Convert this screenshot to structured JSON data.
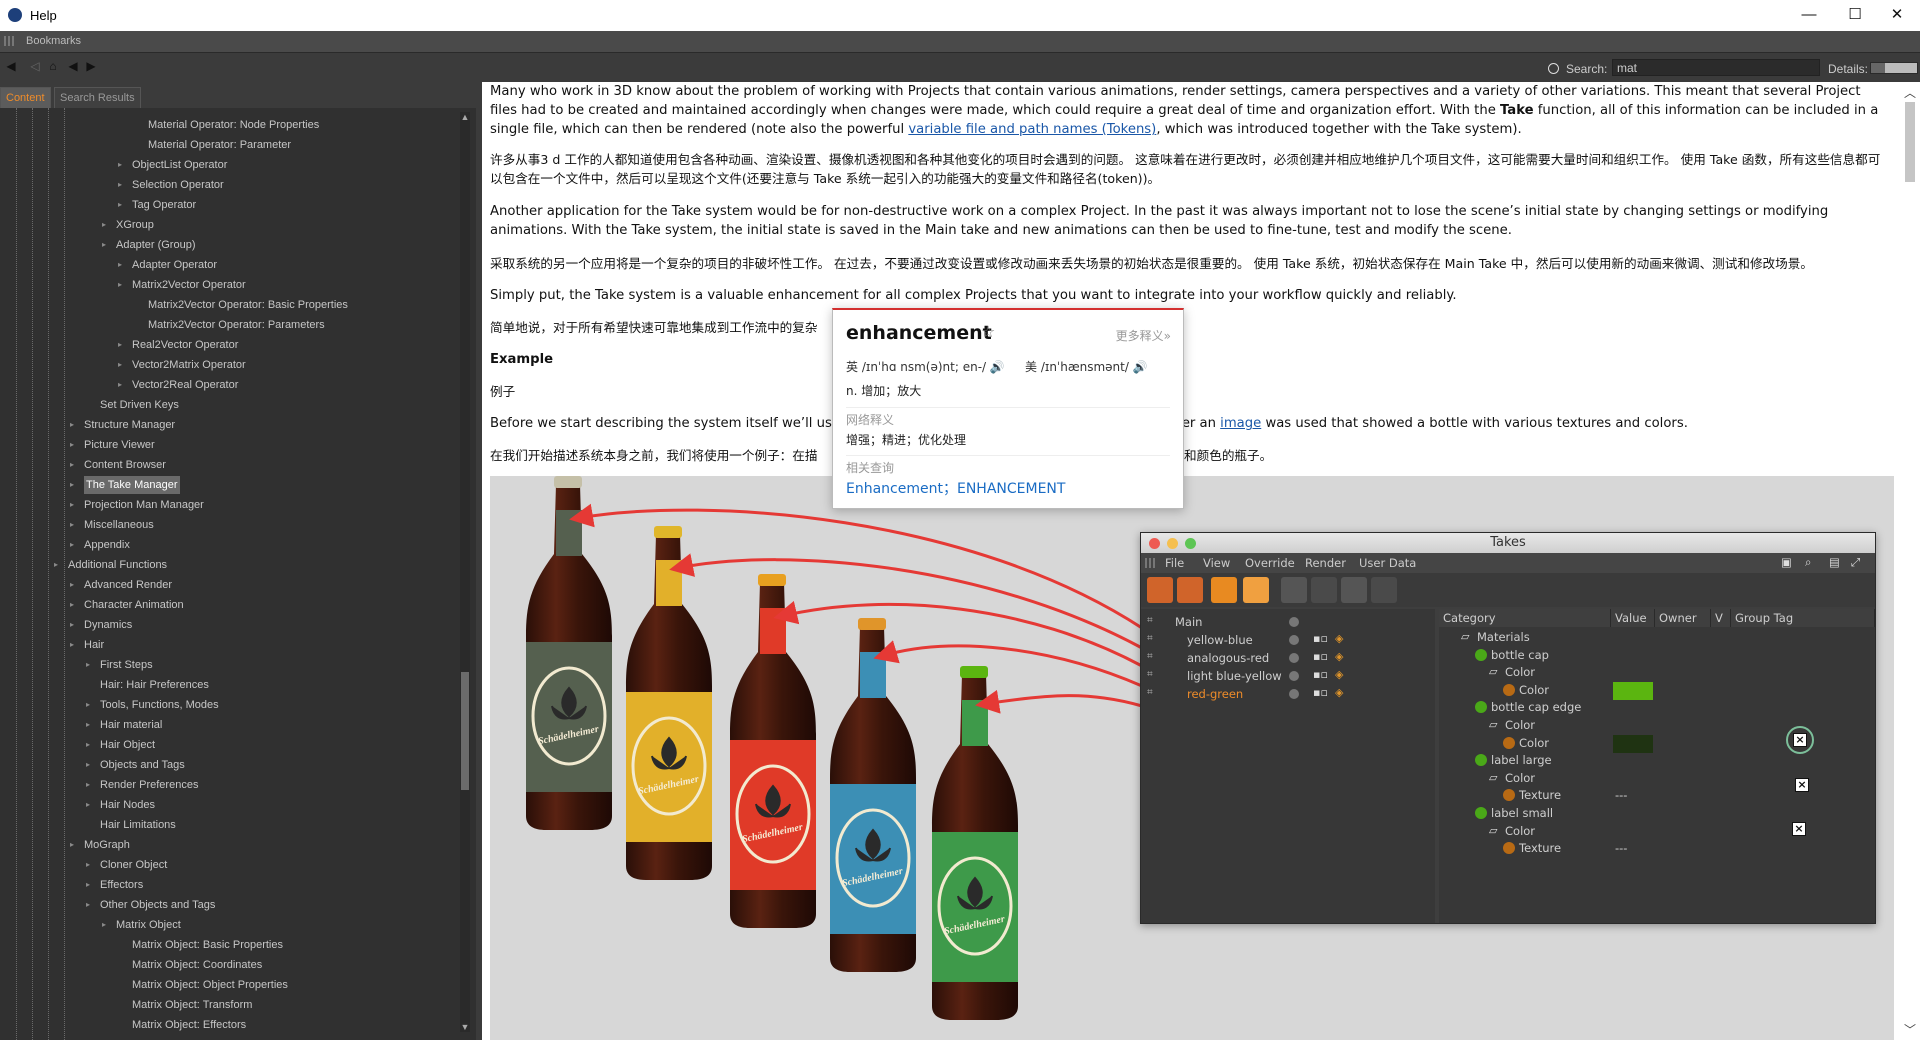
{
  "window": {
    "title": "Help",
    "minimize": "—",
    "maximize": "☐",
    "close": "✕"
  },
  "bookmarks": {
    "label": "Bookmarks"
  },
  "toolbar": {
    "search_label": "Search:",
    "search_value": "mat",
    "details_label": "Details:",
    "details_level": 0.7
  },
  "tabs": [
    {
      "label": "Content",
      "active": true
    },
    {
      "label": "Search Results",
      "active": false
    }
  ],
  "sidebar": {
    "items": [
      {
        "label": "Material Operator: Node Properties",
        "level": 5,
        "expandable": false
      },
      {
        "label": "Material Operator: Parameter",
        "level": 5,
        "expandable": false
      },
      {
        "label": "ObjectList Operator",
        "level": 4,
        "expandable": true
      },
      {
        "label": "Selection Operator",
        "level": 4,
        "expandable": true
      },
      {
        "label": "Tag Operator",
        "level": 4,
        "expandable": true
      },
      {
        "label": "XGroup",
        "level": 3,
        "expandable": true
      },
      {
        "label": "Adapter (Group)",
        "level": 3,
        "expandable": true
      },
      {
        "label": "Adapter Operator",
        "level": 4,
        "expandable": true
      },
      {
        "label": "Matrix2Vector Operator",
        "level": 4,
        "expandable": true
      },
      {
        "label": "Matrix2Vector Operator: Basic Properties",
        "level": 5,
        "expandable": false
      },
      {
        "label": "Matrix2Vector Operator: Parameters",
        "level": 5,
        "expandable": false
      },
      {
        "label": "Real2Vector Operator",
        "level": 4,
        "expandable": true
      },
      {
        "label": "Vector2Matrix Operator",
        "level": 4,
        "expandable": true
      },
      {
        "label": "Vector2Real Operator",
        "level": 4,
        "expandable": true
      },
      {
        "label": "Set Driven Keys",
        "level": 2,
        "expandable": false
      },
      {
        "label": "Structure Manager",
        "level": 1,
        "expandable": true
      },
      {
        "label": "Picture Viewer",
        "level": 1,
        "expandable": true
      },
      {
        "label": "Content Browser",
        "level": 1,
        "expandable": true
      },
      {
        "label": "The Take Manager",
        "level": 1,
        "expandable": true,
        "selected": true
      },
      {
        "label": "Projection Man Manager",
        "level": 1,
        "expandable": true
      },
      {
        "label": "Miscellaneous",
        "level": 1,
        "expandable": true
      },
      {
        "label": "Appendix",
        "level": 1,
        "expandable": true
      },
      {
        "label": "Additional Functions",
        "level": 0,
        "expandable": true
      },
      {
        "label": "Advanced Render",
        "level": 1,
        "expandable": true
      },
      {
        "label": "Character Animation",
        "level": 1,
        "expandable": true
      },
      {
        "label": "Dynamics",
        "level": 1,
        "expandable": true
      },
      {
        "label": "Hair",
        "level": 1,
        "expandable": true
      },
      {
        "label": "First Steps",
        "level": 2,
        "expandable": true
      },
      {
        "label": "Hair: Hair Preferences",
        "level": 2,
        "expandable": false
      },
      {
        "label": "Tools, Functions, Modes",
        "level": 2,
        "expandable": true
      },
      {
        "label": "Hair material",
        "level": 2,
        "expandable": true
      },
      {
        "label": "Hair Object",
        "level": 2,
        "expandable": true
      },
      {
        "label": "Objects and Tags",
        "level": 2,
        "expandable": true
      },
      {
        "label": "Render Preferences",
        "level": 2,
        "expandable": true
      },
      {
        "label": "Hair Nodes",
        "level": 2,
        "expandable": true
      },
      {
        "label": "Hair Limitations",
        "level": 2,
        "expandable": false
      },
      {
        "label": "MoGraph",
        "level": 1,
        "expandable": true
      },
      {
        "label": "Cloner Object",
        "level": 2,
        "expandable": true
      },
      {
        "label": "Effectors",
        "level": 2,
        "expandable": true
      },
      {
        "label": "Other Objects and Tags",
        "level": 2,
        "expandable": true
      },
      {
        "label": "Matrix Object",
        "level": 3,
        "expandable": true
      },
      {
        "label": "Matrix Object: Basic Properties",
        "level": 4,
        "expandable": false
      },
      {
        "label": "Matrix Object: Coordinates",
        "level": 4,
        "expandable": false
      },
      {
        "label": "Matrix Object: Object Properties",
        "level": 4,
        "expandable": false
      },
      {
        "label": "Matrix Object: Transform",
        "level": 4,
        "expandable": false
      },
      {
        "label": "Matrix Object: Effectors",
        "level": 4,
        "expandable": false
      }
    ]
  },
  "content": {
    "p1a": "Many who work in 3D know about the problem of working with Projects that contain various animations, render settings, camera perspectives and a variety of other variations. This meant that several Project files had to be created and maintained accordingly when changes were made, which could require a great deal of time and organization effort. With the ",
    "p1b": "Take",
    "p1c": " function, all of this information can be included in a single file, which can then be rendered (note also the powerful ",
    "p1_link": "variable file and path names (Tokens)",
    "p1d": ", which was introduced together with the Take system).",
    "p2": "许多从事3 d 工作的人都知道使用包含各种动画、渲染设置、摄像机透视图和各种其他变化的项目时会遇到的问题。 这意味着在进行更改时，必须创建并相应地维护几个项目文件，这可能需要大量时间和组织工作。 使用 Take 函数，所有这些信息都可以包含在一个文件中，然后可以呈现这个文件(还要注意与 Take 系统一起引入的功能强大的变量文件和路径名(token))。",
    "p3": "Another application for the Take system would be for non-destructive work on a complex Project. In the past it was always important not to lose the scene’s initial state by changing settings or modifying animations. With the Take system, the initial state is saved in the Main take and new animations can then be used to fine-tune, test and modify the scene.",
    "p4": "采取系统的另一个应用将是一个复杂的项目的非破坏性工作。 在过去，不要通过改变设置或修改动画来丢失场景的初始状态是很重要的。 使用 Take 系统，初始状态保存在 Main Take 中，然后可以使用新的动画来微调、测试和修改场景。",
    "p5a": "Simply put, the Take system is a valuable ",
    "p5_highlight": "enhancement",
    "p5b": " for all complex Projects that you want to integrate into your workflow quickly and reliably.",
    "p6": "简单地说，对于所有希望快速可靠地集成到工作流中的复杂",
    "h_example": "Example",
    "p7": "例子",
    "p8a": "Before we start describing the system itself we’ll us",
    "p8b": "er an ",
    "p8_link": "image",
    "p8c": " was used that showed a bottle with various textures and colors.",
    "p9a": "在我们开始描述系统本身之前，我们将使用一个例子：在描",
    "p9b": "理和颜色的瓶子。"
  },
  "popup": {
    "word": "enhancement",
    "star": "☆",
    "more": "更多释义»",
    "ph_uk": "英 /ɪnˈhɑ nsm(ə)nt; en-/",
    "ph_us": "美 /ɪnˈhænsmənt/",
    "speaker": "🔊",
    "definition": "n. 增加；放大",
    "web_label": "网络释义",
    "web_def": "增强；精进；优化处理",
    "related_label": "相关查询",
    "related_1": "Enhancement",
    "related_sep": "；",
    "related_2": "ENHANCEMENT"
  },
  "bottle_labels": {
    "brand": "Schädelheimer"
  },
  "takes_window": {
    "title": "Takes",
    "menu": [
      "File",
      "View",
      "Override",
      "Render",
      "User Data"
    ],
    "take_rows": [
      {
        "name": "Main",
        "active": false
      },
      {
        "name": "yellow-blue",
        "active": false
      },
      {
        "name": "analogous-red",
        "active": false
      },
      {
        "name": "light blue-yellow",
        "active": false
      },
      {
        "name": "red-green",
        "active": true
      }
    ],
    "columns": [
      "Category",
      "Value",
      "Owner",
      "V",
      "Group Tag"
    ],
    "tree": [
      {
        "label": "Materials",
        "indent": 1,
        "value": ""
      },
      {
        "label": "bottle cap",
        "indent": 2,
        "value": ""
      },
      {
        "label": "Color",
        "indent": 3,
        "value": ""
      },
      {
        "label": "Color",
        "indent": 4,
        "value": "swatch-green"
      },
      {
        "label": "bottle cap edge",
        "indent": 2,
        "value": ""
      },
      {
        "label": "Color",
        "indent": 3,
        "value": ""
      },
      {
        "label": "Color",
        "indent": 4,
        "value": "swatch-dark"
      },
      {
        "label": "label large",
        "indent": 2,
        "value": ""
      },
      {
        "label": "Color",
        "indent": 3,
        "value": ""
      },
      {
        "label": "Texture",
        "indent": 4,
        "value": "---"
      },
      {
        "label": "label small",
        "indent": 2,
        "value": ""
      },
      {
        "label": "Color",
        "indent": 3,
        "value": ""
      },
      {
        "label": "Texture",
        "indent": 4,
        "value": "---"
      }
    ]
  },
  "colors": {
    "accent_orange": "#ef8c2a",
    "link_blue": "#1a57a8",
    "arrow_red": "#e53935",
    "swatch_green": "#5bb510",
    "swatch_dark": "#1f3312"
  }
}
